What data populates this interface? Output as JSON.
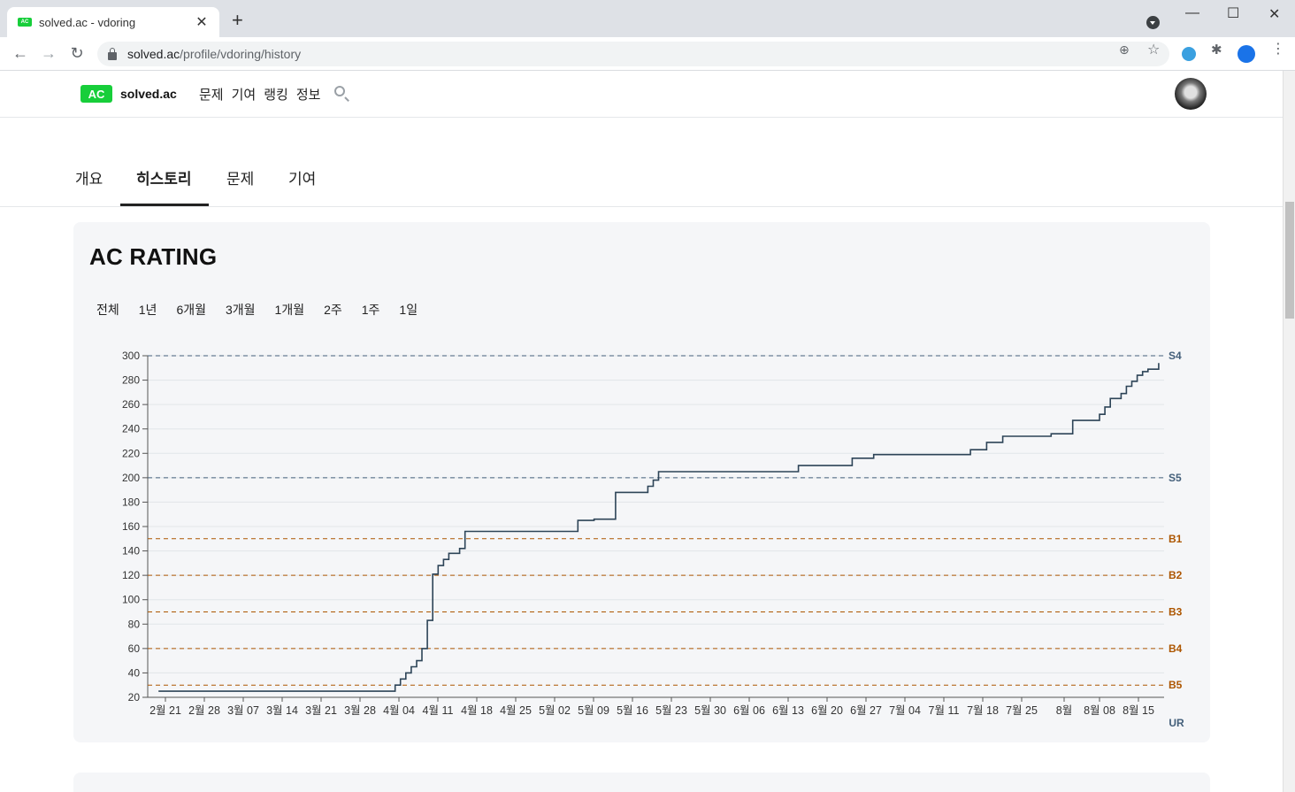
{
  "browser": {
    "tab_title": "solved.ac - vdoring",
    "favicon_text": "AC",
    "url_host": "solved.ac",
    "url_path": "/profile/vdoring/history"
  },
  "site": {
    "logo_text": "AC",
    "brand": "solved.ac",
    "nav": [
      "문제",
      "기여",
      "랭킹",
      "정보"
    ]
  },
  "profile_tabs": [
    "개요",
    "히스토리",
    "문제",
    "기여"
  ],
  "active_tab": "히스토리",
  "card": {
    "title": "AC RATING",
    "ranges": [
      "전체",
      "1년",
      "6개월",
      "3개월",
      "1개월",
      "2주",
      "1주",
      "1일"
    ]
  },
  "colors": {
    "accent": "#17ce3a",
    "line": "#2d4457",
    "silver": "#435f7a",
    "bronze": "#ad5600",
    "grid": "#e2e5e9"
  },
  "chart_data": {
    "type": "line",
    "title": "AC RATING",
    "xlabel": "",
    "ylabel": "",
    "ylim": [
      20,
      300
    ],
    "yticks": [
      20,
      40,
      60,
      80,
      100,
      120,
      140,
      160,
      180,
      200,
      220,
      240,
      260,
      280,
      300
    ],
    "x_tick_labels": [
      "2월 21",
      "2월 28",
      "3월 07",
      "3월 14",
      "3월 21",
      "3월 28",
      "4월 04",
      "4월 11",
      "4월 18",
      "4월 25",
      "5월 02",
      "5월 09",
      "5월 16",
      "5월 23",
      "5월 30",
      "6월 06",
      "6월 13",
      "6월 20",
      "6월 27",
      "7월 04",
      "7월 11",
      "7월 18",
      "7월 25",
      "8월",
      "8월 08",
      "8월 15"
    ],
    "x_corner_label": "UR",
    "tiers": [
      {
        "label": "S4",
        "value": 300,
        "tier": "silver"
      },
      {
        "label": "S5",
        "value": 200,
        "tier": "silver"
      },
      {
        "label": "B1",
        "value": 150,
        "tier": "bronze"
      },
      {
        "label": "B2",
        "value": 120,
        "tier": "bronze"
      },
      {
        "label": "B3",
        "value": 90,
        "tier": "bronze"
      },
      {
        "label": "B4",
        "value": 60,
        "tier": "bronze"
      },
      {
        "label": "B5",
        "value": 30,
        "tier": "bronze"
      }
    ],
    "series": [
      {
        "step": true,
        "x": [
          "2021-02-19",
          "2021-04-04",
          "2021-04-05",
          "2021-04-06",
          "2021-04-07",
          "2021-04-08",
          "2021-04-09",
          "2021-04-10",
          "2021-04-11",
          "2021-04-12",
          "2021-04-13",
          "2021-04-14",
          "2021-04-16",
          "2021-04-17",
          "2021-05-08",
          "2021-05-11",
          "2021-05-15",
          "2021-05-21",
          "2021-05-22",
          "2021-05-23",
          "2021-06-18",
          "2021-06-28",
          "2021-07-02",
          "2021-07-20",
          "2021-07-23",
          "2021-07-26",
          "2021-08-04",
          "2021-08-08",
          "2021-08-13",
          "2021-08-14",
          "2021-08-15",
          "2021-08-17",
          "2021-08-18",
          "2021-08-19",
          "2021-08-20",
          "2021-08-21",
          "2021-08-22",
          "2021-08-24"
        ],
        "y": [
          25,
          30,
          35,
          40,
          45,
          50,
          60,
          83,
          121,
          128,
          133,
          138,
          142,
          156,
          165,
          166,
          188,
          193,
          198,
          205,
          210,
          216,
          219,
          223,
          229,
          234,
          236,
          247,
          252,
          258,
          265,
          269,
          275,
          279,
          284,
          287,
          289,
          294
        ]
      }
    ],
    "grid": true,
    "legend": "none"
  }
}
